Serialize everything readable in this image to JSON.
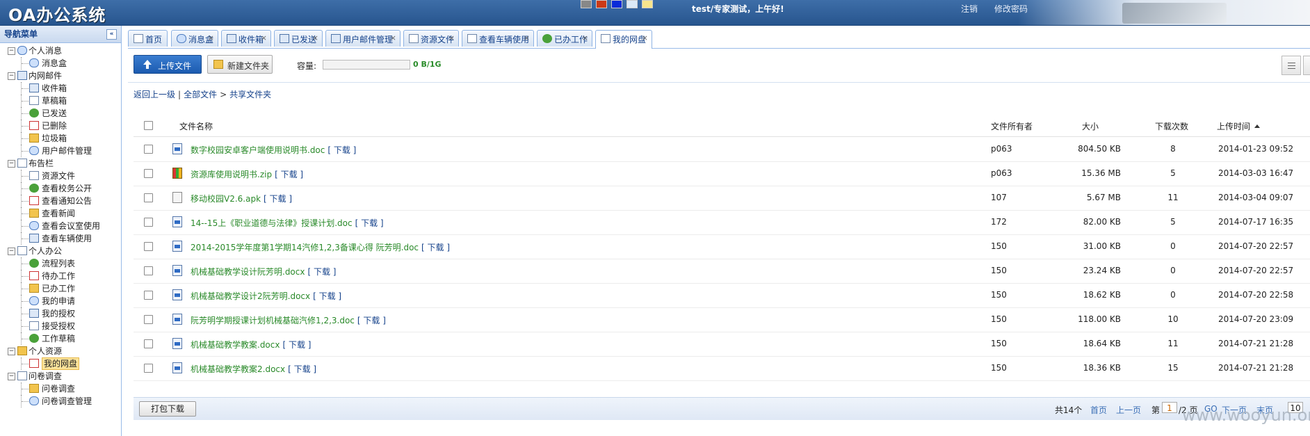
{
  "header": {
    "title": "OA办公系统",
    "greeting": "test/专家测试，上午好!",
    "logout": "注销",
    "change_password": "修改密码",
    "color_swatches": [
      "#888888",
      "#cc3a16",
      "#0a2bd8",
      "#dbe9f7",
      "#f7e58d"
    ]
  },
  "sidebar": {
    "title": "导航菜单",
    "collapse_icon": "«",
    "tree": [
      {
        "label": "个人消息",
        "icon": "chat-icon",
        "children": [
          "消息盒"
        ]
      },
      {
        "label": "内网邮件",
        "icon": "mail-icon",
        "children": [
          "收件箱",
          "草稿箱",
          "已发送",
          "已删除",
          "垃圾箱",
          "用户邮件管理"
        ]
      },
      {
        "label": "布告栏",
        "icon": "board-icon",
        "children": [
          "资源文件",
          "查看校务公开",
          "查看通知公告",
          "查看新闻",
          "查看会议室使用",
          "查看车辆使用"
        ]
      },
      {
        "label": "个人办公",
        "icon": "office-icon",
        "children": [
          "流程列表",
          "待办工作",
          "已办工作",
          "我的申请",
          "我的授权",
          "接受授权",
          "工作草稿"
        ]
      },
      {
        "label": "个人资源",
        "icon": "resource-icon",
        "children": [
          "我的网盘"
        ]
      },
      {
        "label": "问卷调查",
        "icon": "survey-icon",
        "children": [
          "问卷调查",
          "问卷调查管理"
        ]
      }
    ],
    "selected": "我的网盘"
  },
  "tabs": [
    {
      "label": "首页",
      "closable": false
    },
    {
      "label": "消息盒",
      "closable": true
    },
    {
      "label": "收件箱",
      "closable": true
    },
    {
      "label": "已发送",
      "closable": true
    },
    {
      "label": "用户邮件管理",
      "closable": true
    },
    {
      "label": "资源文件",
      "closable": true
    },
    {
      "label": "查看车辆使用",
      "closable": true
    },
    {
      "label": "已办工作",
      "closable": true
    },
    {
      "label": "我的网盘",
      "closable": true,
      "active": true
    }
  ],
  "toolbar": {
    "upload_label": "上传文件",
    "new_folder_label": "新建文件夹",
    "capacity_label": "容量:",
    "capacity_value": "0 B/1G"
  },
  "breadcrumb": {
    "back": "返回上一级",
    "all_files": "全部文件",
    "current": "共享文件夹"
  },
  "table": {
    "columns": [
      "文件名称",
      "文件所有者",
      "大小",
      "下载次数",
      "上传时间"
    ],
    "download_label": "[ 下载 ]",
    "rows": [
      {
        "name": "数字校园安卓客户端使用说明书.doc",
        "type": "doc",
        "owner": "p063",
        "size": "804.50 KB",
        "downloads": "8",
        "time": "2014-01-23 09:52"
      },
      {
        "name": "资源库使用说明书.zip",
        "type": "zip",
        "owner": "p063",
        "size": "15.36 MB",
        "downloads": "5",
        "time": "2014-03-03 16:47"
      },
      {
        "name": "移动校园V2.6.apk",
        "type": "apk",
        "owner": "107",
        "size": "5.67 MB",
        "downloads": "11",
        "time": "2014-03-04 09:07"
      },
      {
        "name": "14--15上《职业道德与法律》授课计划.doc",
        "type": "doc",
        "owner": "172",
        "size": "82.00 KB",
        "downloads": "5",
        "time": "2014-07-17 16:35"
      },
      {
        "name": "2014-2015学年度第1学期14汽修1,2,3备课心得 阮芳明.doc",
        "type": "doc",
        "owner": "150",
        "size": "31.00 KB",
        "downloads": "0",
        "time": "2014-07-20 22:57"
      },
      {
        "name": "机械基础教学设计阮芳明.docx",
        "type": "doc",
        "owner": "150",
        "size": "23.24 KB",
        "downloads": "0",
        "time": "2014-07-20 22:57"
      },
      {
        "name": "机械基础教学设计2阮芳明.docx",
        "type": "doc",
        "owner": "150",
        "size": "18.62 KB",
        "downloads": "0",
        "time": "2014-07-20 22:58"
      },
      {
        "name": "阮芳明学期授课计划机械基础汽修1,2,3.doc",
        "type": "doc",
        "owner": "150",
        "size": "118.00 KB",
        "downloads": "10",
        "time": "2014-07-20 23:09"
      },
      {
        "name": "机械基础教学教案.docx",
        "type": "doc",
        "owner": "150",
        "size": "18.64 KB",
        "downloads": "11",
        "time": "2014-07-21 21:28"
      },
      {
        "name": "机械基础教学教案2.docx",
        "type": "doc",
        "owner": "150",
        "size": "18.36 KB",
        "downloads": "15",
        "time": "2014-07-21 21:28"
      }
    ]
  },
  "footer": {
    "pack_download": "打包下载",
    "total": "共14个",
    "first": "首页",
    "prev": "上一页",
    "page_prefix": "第",
    "page_value": "1",
    "page_suffix": "/2 页",
    "go": "GO",
    "next": "下一页",
    "last": "末页",
    "page_size": "10"
  },
  "watermark": "www.wooyun.org"
}
